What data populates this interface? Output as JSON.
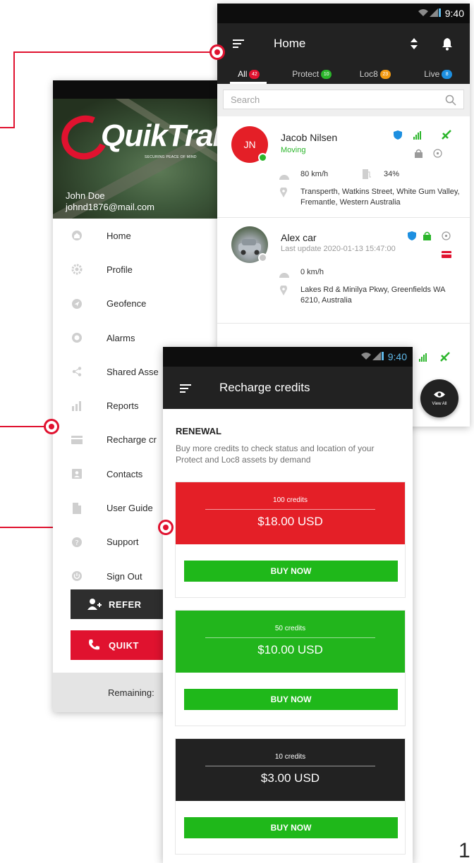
{
  "drawer": {
    "brand": "QuikTrak",
    "tagline": "SECURING PEACE OF MIND",
    "user_name": "John Doe",
    "user_email": "johnd1876@mail.com",
    "menu": [
      {
        "label": "Home",
        "icon": "home-icon"
      },
      {
        "label": "Profile",
        "icon": "gear-icon"
      },
      {
        "label": "Geofence",
        "icon": "navigation-icon"
      },
      {
        "label": "Alarms",
        "icon": "alarm-icon"
      },
      {
        "label": "Shared Asse",
        "icon": "share-icon"
      },
      {
        "label": "Reports",
        "icon": "bar-chart-icon"
      },
      {
        "label": "Recharge cr",
        "icon": "card-icon"
      },
      {
        "label": "Contacts",
        "icon": "contact-icon"
      },
      {
        "label": "User Guide",
        "icon": "document-icon"
      },
      {
        "label": "Support",
        "icon": "help-icon"
      },
      {
        "label": "Sign Out",
        "icon": "power-icon"
      }
    ],
    "refer_label": "REFER",
    "quik_label": "QUIKT",
    "remaining_label": "Remaining:"
  },
  "home": {
    "status_time": "9:40",
    "title": "Home",
    "tabs": [
      {
        "label": "All",
        "badge": "42",
        "badge_color": "#e0122f"
      },
      {
        "label": "Protect",
        "badge": "10",
        "badge_color": "#2bb52b"
      },
      {
        "label": "Loc8",
        "badge": "23",
        "badge_color": "#f39a12"
      },
      {
        "label": "Live",
        "badge": "8",
        "badge_color": "#1d8fe0"
      }
    ],
    "search_placeholder": "Search",
    "assets": [
      {
        "initials": "JN",
        "name": "Jacob Nilsen",
        "status": "Moving",
        "speed": "80 km/h",
        "battery": "34%",
        "address": "Transperth, Watkins Street, White Gum Valley, Fremantle, Western Australia"
      },
      {
        "name": "Alex car",
        "status": "Last update 2020-01-13 15:47:00",
        "speed": "0 km/h",
        "address": "Lakes Rd & Minilya Pkwy, Greenfields WA 6210, Australia"
      }
    ],
    "fab_label": "View All"
  },
  "recharge": {
    "status_time": "9:40",
    "title": "Recharge credits",
    "section": "RENEWAL",
    "description": "Buy more credits to check status and location of your Protect and Loc8 assets by demand",
    "packages": [
      {
        "credits": "100 credits",
        "price": "$18.00 USD",
        "color": "#e41f27",
        "button": "BUY NOW"
      },
      {
        "credits": "50 credits",
        "price": "$10.00 USD",
        "color": "#22b51c",
        "button": "BUY NOW"
      },
      {
        "credits": "10 credits",
        "price": "$3.00 USD",
        "color": "#222222",
        "button": "BUY NOW"
      }
    ]
  },
  "colors": {
    "accent": "#e0122f",
    "green": "#1fb81a",
    "dark": "#222222"
  },
  "page_number": "1"
}
